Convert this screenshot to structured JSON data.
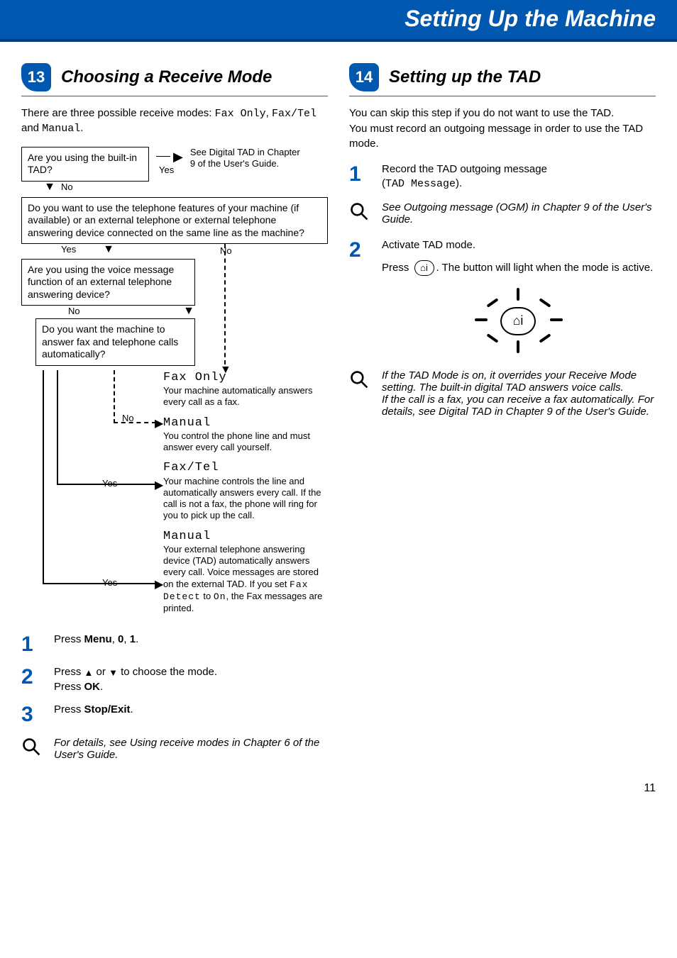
{
  "header": {
    "title": "Setting Up the Machine"
  },
  "left": {
    "section_number": "13",
    "section_title": "Choosing a Receive Mode",
    "intro_pre": "There are three possible receive modes: ",
    "intro_modes": {
      "a": "Fax Only",
      "b": "Fax/Tel",
      "c": "Manual"
    },
    "intro_mid1": ", ",
    "intro_mid2": " and ",
    "intro_end": ".",
    "fc": {
      "box1": "Are you using the built-in TAD?",
      "box1_yes_label": "Yes",
      "box1_yes_dest": "See Digital TAD in Chapter 9 of the User's Guide.",
      "box1_no_label": "No",
      "box2": "Do you want to use the telephone features of your machine (if available) or an external telephone or external telephone answering device connected on the same line as the machine?",
      "box2_yes": "Yes",
      "box2_no": "No",
      "box3": "Are you using the voice message function of an external telephone answering device?",
      "box3_no": "No",
      "box3_yes": "Yes",
      "box4": "Do you want the machine to answer fax and telephone calls automatically?",
      "box4_no": "No",
      "box4_yes": "Yes",
      "r_faxonly_title": "Fax Only",
      "r_faxonly_body": "Your machine automatically answers every call as a fax.",
      "r_manual1_title": "Manual",
      "r_manual1_body": "You control the phone line and must answer every call yourself.",
      "r_faxtel_title": "Fax/Tel",
      "r_faxtel_body": "Your machine controls the line and automatically answers every call. If the call is not a fax, the phone will ring for you to pick up the call.",
      "r_manual2_title": "Manual",
      "r_manual2_body_pre": "Your external telephone answering device (TAD) automatically answers every call. Voice messages are stored on the external TAD. If you set ",
      "r_manual2_code1": "Fax Detect",
      "r_manual2_mid": " to ",
      "r_manual2_code2": "On",
      "r_manual2_end": ", the Fax messages are printed."
    },
    "steps": {
      "s1_pre": "Press ",
      "s1_menu": "Menu",
      "s1_mids": [
        ", ",
        ", "
      ],
      "s1_k0": "0",
      "s1_k1": "1",
      "s1_end": ".",
      "s2_pre": "Press ",
      "s2_mid": " or ",
      "s2_post": " to choose the mode.",
      "s2_line2_pre": "Press ",
      "s2_ok": "OK",
      "s2_line2_end": ".",
      "s3_pre": "Press ",
      "s3_btn": "Stop/Exit",
      "s3_end": "."
    },
    "note": " For details, see Using receive modes in Chapter 6 of the User's Guide."
  },
  "right": {
    "section_number": "14",
    "section_title": "Setting up the TAD",
    "para1": "You can skip this step if you do not want to use the TAD.",
    "para2": "You must record an outgoing message in order to use the TAD mode.",
    "step1_line1": "Record the TAD outgoing message",
    "step1_line2_pre": "(",
    "step1_code": "TAD Message",
    "step1_line2_post": ").",
    "note1": "See Outgoing message (OGM) in Chapter 9 of the User's Guide.",
    "step2_line1": "Activate TAD mode.",
    "step2_line2_pre": "Press ",
    "step2_line2_post": ". The button will light when the mode is active.",
    "tad_symbol": "⌂i",
    "note2": "If the TAD Mode is on, it overrides your Receive Mode setting. The built-in digital TAD answers voice calls.\nIf the call is a fax, you can receive a fax automatically. For details, see Digital TAD in Chapter 9 of the User's Guide."
  },
  "page_number": "11"
}
